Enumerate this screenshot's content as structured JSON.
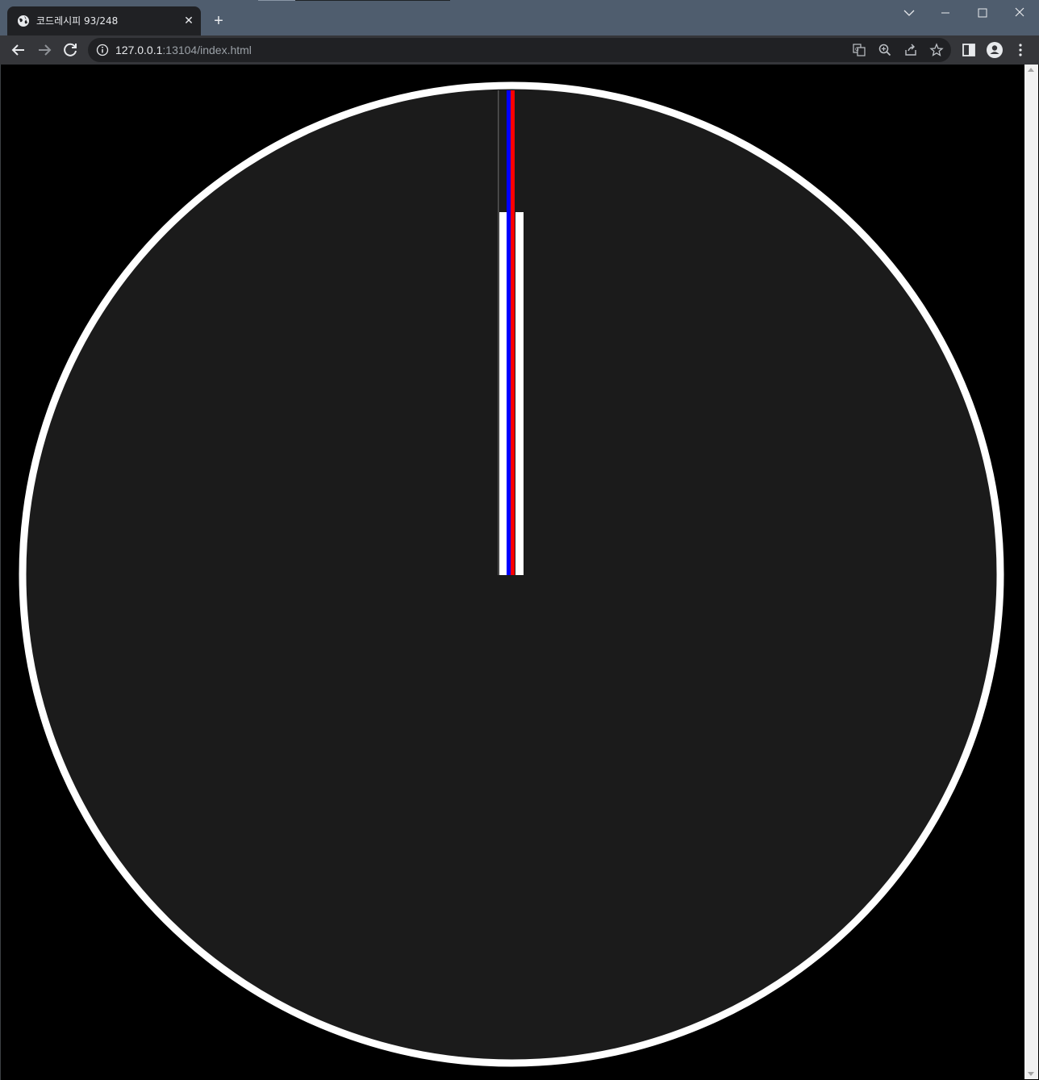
{
  "browser": {
    "tab": {
      "title": "코드레시피 93/248",
      "favicon": "globe-icon",
      "close_glyph": "✕"
    },
    "new_tab_glyph": "+",
    "address": {
      "host": "127.0.0.1",
      "rest": ":13104/index.html"
    },
    "colors": {
      "titlebar": "#4f5d6e",
      "toolbar": "#35363a",
      "omnibox": "#202124"
    }
  },
  "clock": {
    "colors": {
      "page_background": "#000000",
      "face": "#1b1b1b",
      "rim": "#ffffff",
      "hour_hand": "#ffffff",
      "minute_hand": "#0000ff",
      "second_hand": "#ff0000",
      "thin_hand": "#555555"
    },
    "hands_angle_deg": 0
  }
}
